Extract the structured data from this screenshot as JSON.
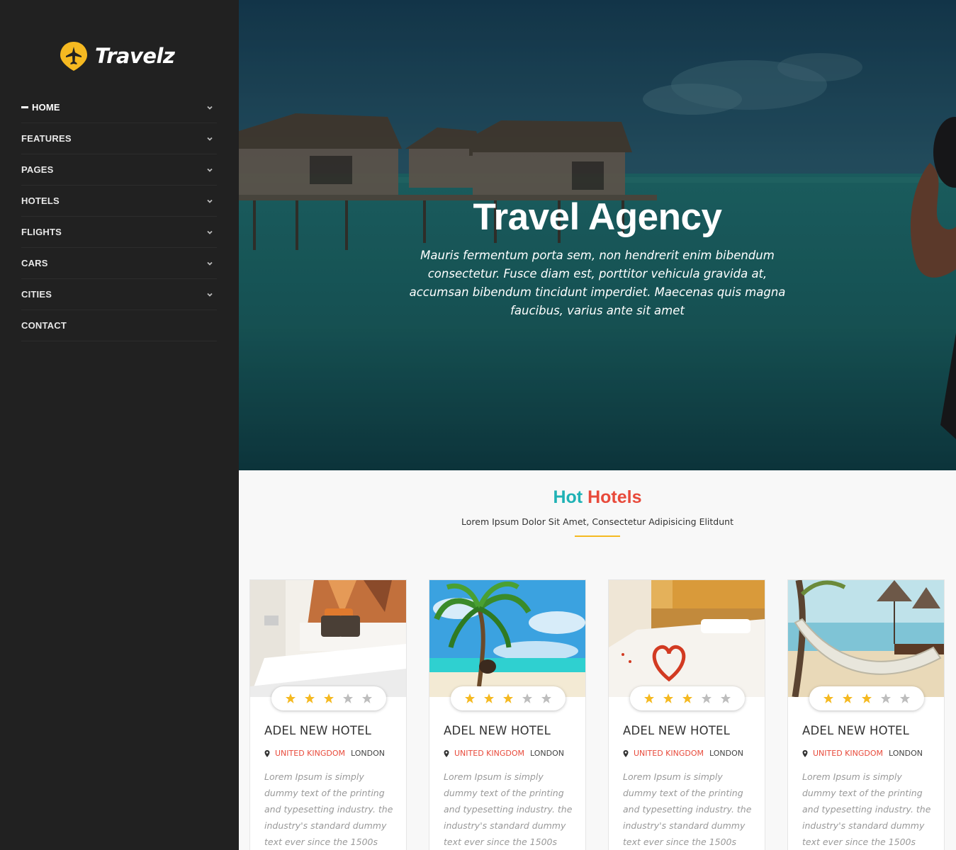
{
  "brand": {
    "name": "Travelz",
    "accent": "#f5b921"
  },
  "nav": [
    {
      "label": "HOME",
      "active": true,
      "dropdown": true
    },
    {
      "label": "FEATURES",
      "dropdown": true
    },
    {
      "label": "PAGES",
      "dropdown": true
    },
    {
      "label": "HOTELS",
      "dropdown": true
    },
    {
      "label": "FLIGHTS",
      "dropdown": true
    },
    {
      "label": "CARS",
      "dropdown": true
    },
    {
      "label": "CITIES",
      "dropdown": true
    },
    {
      "label": "CONTACT",
      "dropdown": false
    }
  ],
  "hero": {
    "title": "Travel Agency",
    "subtitle": "Mauris fermentum porta sem, non hendrerit enim bibendum consectetur. Fusce diam est, porttitor vehicula gravida at, accumsan bibendum tincidunt imperdiet. Maecenas quis magna faucibus, varius ante sit amet"
  },
  "section": {
    "title_part1": "Hot",
    "title_part2": "Hotels",
    "subtitle": "Lorem Ipsum Dolor Sit Amet, Consectetur Adipisicing Elitdunt",
    "colors": {
      "teal": "#1fb2b5",
      "red": "#e84a3b"
    }
  },
  "hotels": [
    {
      "name": "ADEL NEW HOTEL",
      "country": "UNITED KINGDOM",
      "city": "LONDON",
      "rating": 3,
      "max_rating": 5,
      "image": "bedroom-image",
      "description": "Lorem Ipsum is simply dummy text of the printing and typesetting industry. the industry's standard dummy text ever since the 1500s"
    },
    {
      "name": "ADEL NEW HOTEL",
      "country": "UNITED KINGDOM",
      "city": "LONDON",
      "rating": 3,
      "max_rating": 5,
      "image": "palm-beach-image",
      "description": "Lorem Ipsum is simply dummy text of the printing and typesetting industry. the industry's standard dummy text ever since the 1500s"
    },
    {
      "name": "ADEL NEW HOTEL",
      "country": "UNITED KINGDOM",
      "city": "LONDON",
      "rating": 3,
      "max_rating": 5,
      "image": "heart-bed-image",
      "description": "Lorem Ipsum is simply dummy text of the printing and typesetting industry. the industry's standard dummy text ever since the 1500s"
    },
    {
      "name": "ADEL NEW HOTEL",
      "country": "UNITED KINGDOM",
      "city": "LONDON",
      "rating": 3,
      "max_rating": 5,
      "image": "hammock-beach-image",
      "description": "Lorem Ipsum is simply dummy text of the printing and typesetting industry. the industry's standard dummy text ever since the 1500s"
    }
  ]
}
